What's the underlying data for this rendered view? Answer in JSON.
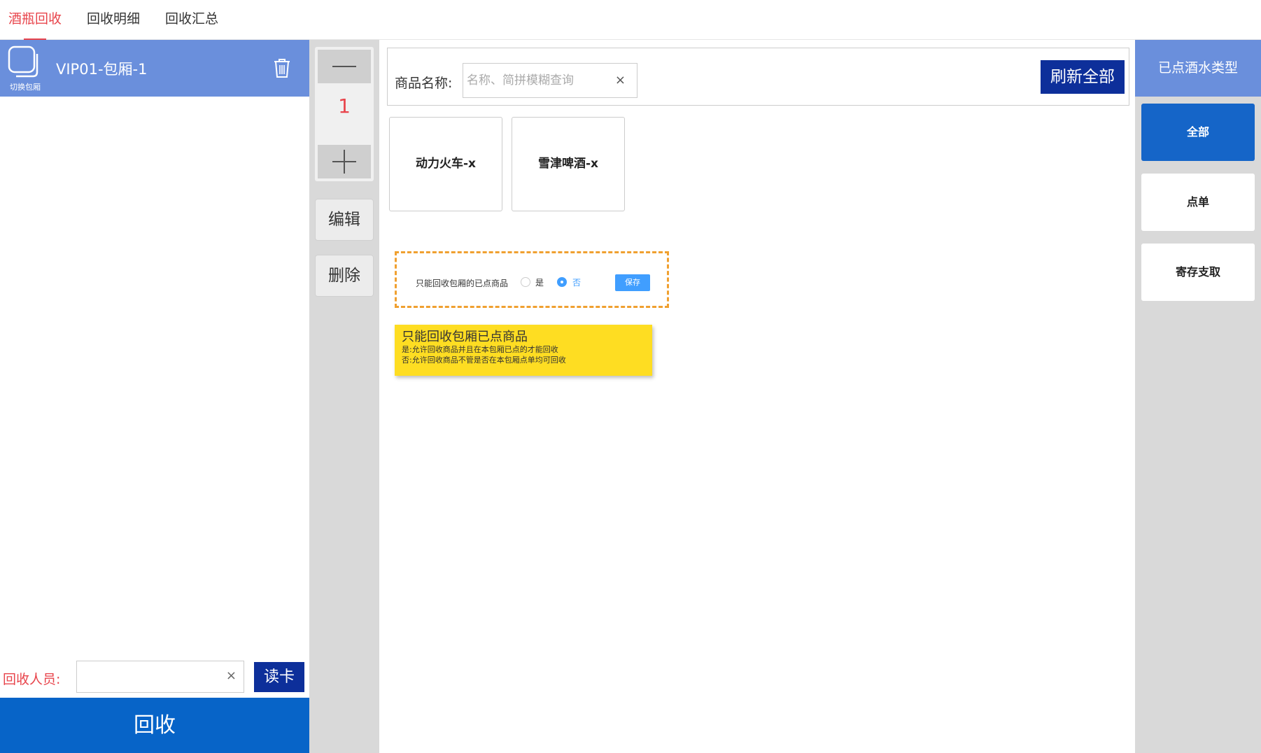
{
  "tabs": [
    {
      "label": "酒瓶回收",
      "active": true
    },
    {
      "label": "回收明细",
      "active": false
    },
    {
      "label": "回收汇总",
      "active": false
    }
  ],
  "left": {
    "switch_label": "切换包厢",
    "room_name": "VIP01-包厢-1",
    "operator_label": "回收人员:",
    "operator_value": "",
    "clear_symbol": "×",
    "readcard_label": "读卡",
    "recycle_label": "回收"
  },
  "middle": {
    "quantity": "1",
    "edit_label": "编辑",
    "delete_label": "删除"
  },
  "main": {
    "search_label": "商品名称:",
    "search_placeholder": "名称、简拼模糊查询",
    "search_value": "",
    "clear_symbol": "×",
    "refresh_label": "刷新全部",
    "products": [
      "动力火车-x",
      "雪津啤酒-x"
    ],
    "setting": {
      "label": "只能回收包厢的已点商品",
      "option_yes": "是",
      "option_no": "否",
      "selected": "否",
      "save_label": "保存"
    },
    "note": {
      "title": "只能回收包厢已点商品",
      "line1": "是:允许回收商品并且在本包厢已点的才能回收",
      "line2": "否:允许回收商品不管是否在本包厢点单均可回收"
    }
  },
  "right": {
    "header": "已点酒水类型",
    "categories": [
      {
        "label": "全部",
        "active": true
      },
      {
        "label": "点单",
        "active": false
      },
      {
        "label": "寄存支取",
        "active": false
      }
    ]
  },
  "colors": {
    "accent_red": "#e8444b",
    "header_blue": "#6a8fdc",
    "dark_blue": "#0d2f9a",
    "primary_blue": "#0764c8",
    "note_yellow": "#fedd22",
    "dash_orange": "#f0a030"
  }
}
